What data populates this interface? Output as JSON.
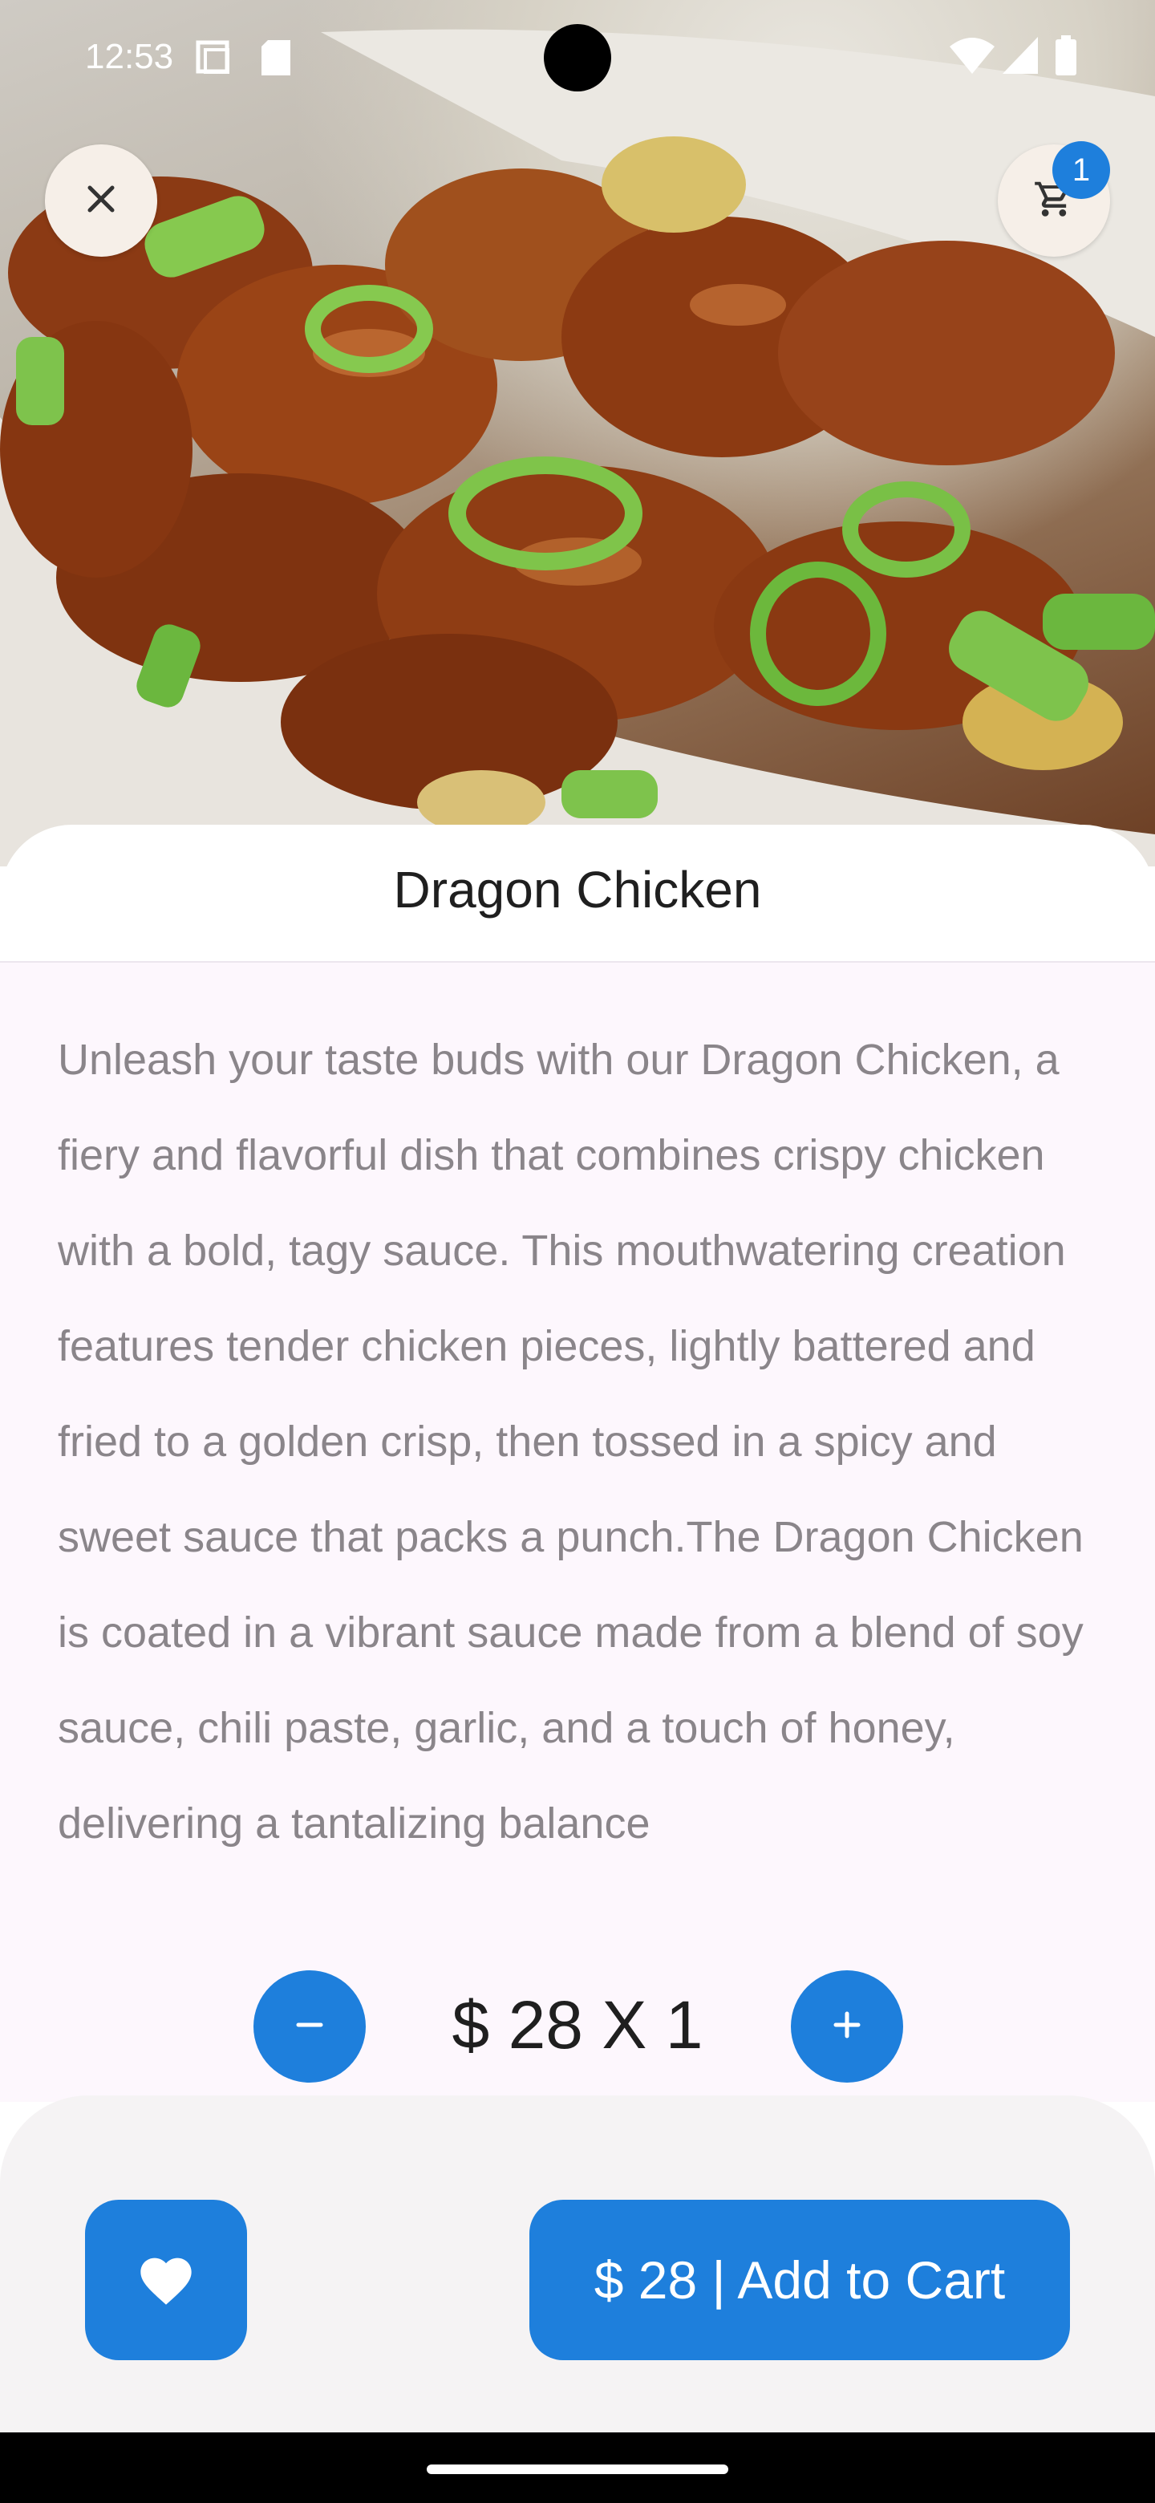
{
  "status_bar": {
    "time": "12:53",
    "icons": [
      "screenshot-icon",
      "sd-card-icon",
      "wifi-icon",
      "signal-icon",
      "battery-icon"
    ]
  },
  "header": {
    "close_icon": "close-icon",
    "cart_icon": "cart-icon",
    "cart_count": "1"
  },
  "product": {
    "title": "Dragon Chicken",
    "description": "Unleash your taste buds with our Dragon Chicken, a fiery and flavorful dish that combines crispy chicken with a bold, tagy sauce. This mouthwatering creation features tender chicken pieces, lightly battered and fried to a golden crisp, then tossed in a spicy and sweet sauce that packs a punch.The Dragon Chicken is coated in a vibrant sauce made from a blend of soy sauce, chili paste, garlic, and a touch of honey, delivering a tantalizing balance"
  },
  "quantity": {
    "minus_icon": "minus-icon",
    "plus_icon": "plus-icon",
    "label": "$ 28 X 1"
  },
  "actions": {
    "favorite_icon": "heart-icon",
    "add_to_cart_label": "$ 28 | Add to Cart"
  },
  "colors": {
    "accent": "#1e7fdc",
    "description_text": "#8a858a",
    "title_text": "#1f1f1f",
    "sheet_background": "#fdf7fd",
    "bottom_panel": "#f5f3f4"
  }
}
